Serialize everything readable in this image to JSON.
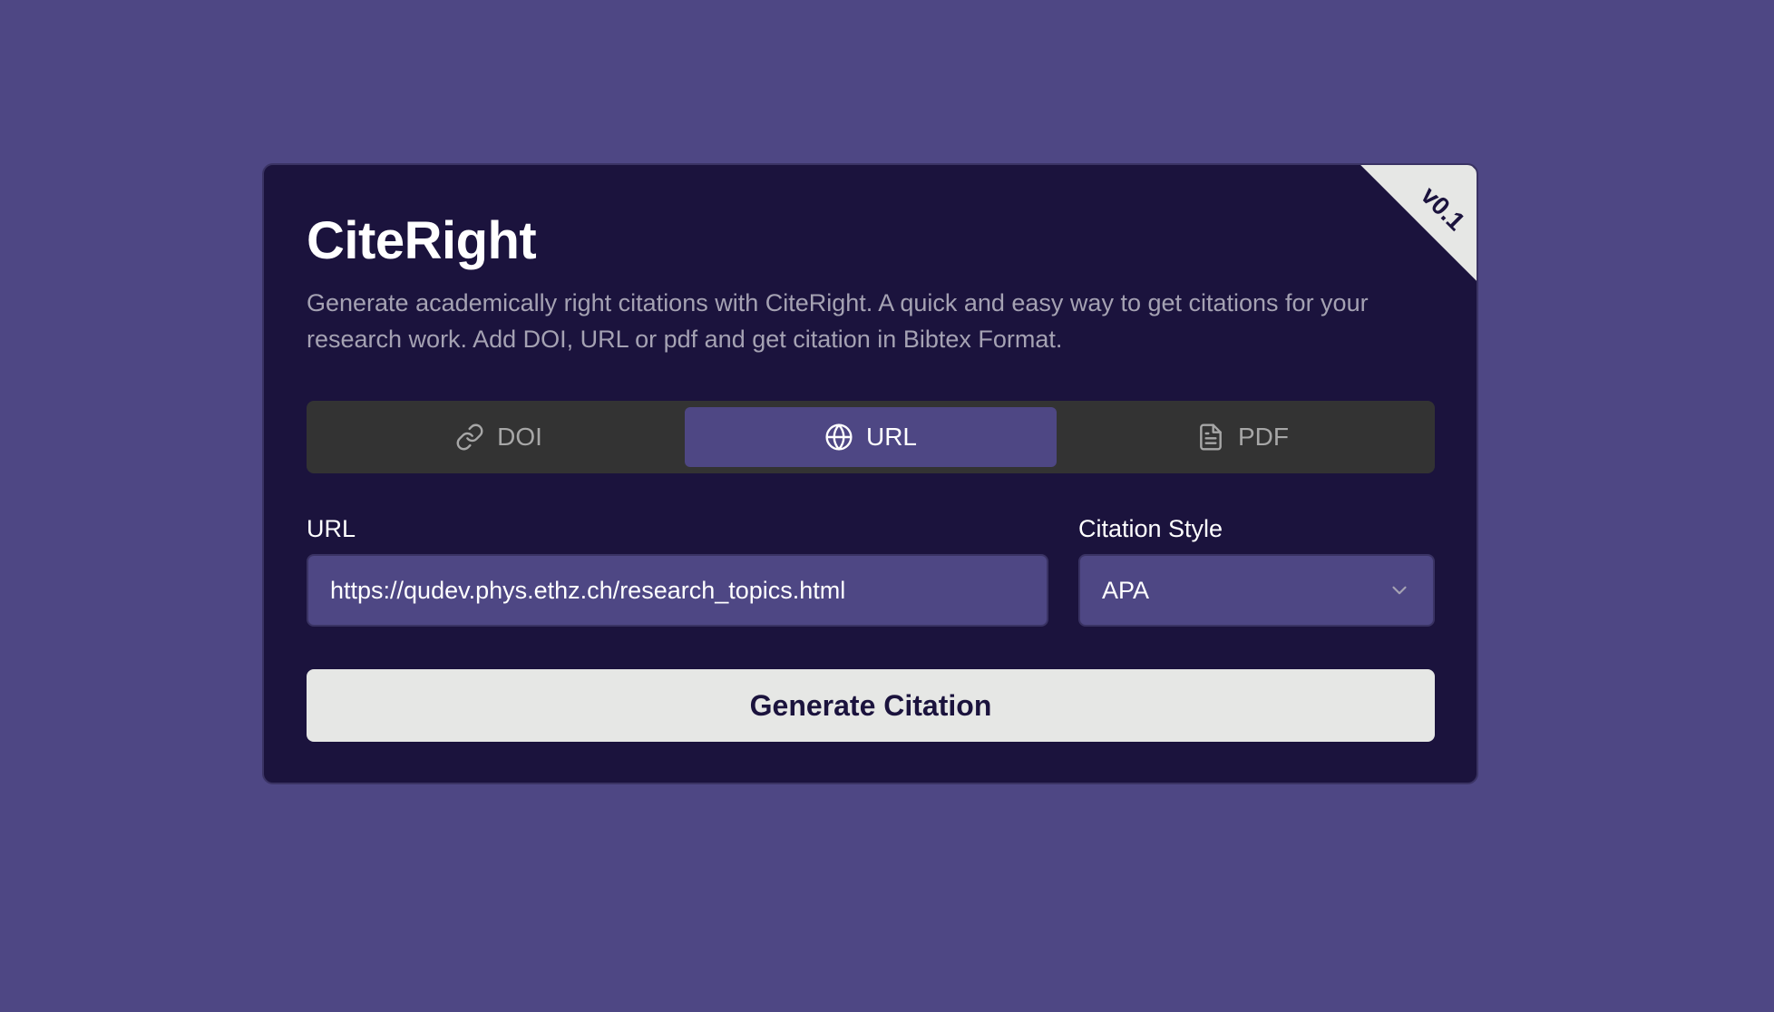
{
  "app": {
    "title": "CiteRight",
    "version": "v0.1",
    "description": "Generate academically right citations with CiteRight. A quick and easy way to get citations for your research work. Add DOI, URL or pdf and get citation in Bibtex Format."
  },
  "tabs": [
    {
      "label": "DOI",
      "icon": "link-icon",
      "active": false
    },
    {
      "label": "URL",
      "icon": "globe-icon",
      "active": true
    },
    {
      "label": "PDF",
      "icon": "file-icon",
      "active": false
    }
  ],
  "form": {
    "url_label": "URL",
    "url_value": "https://qudev.phys.ethz.ch/research_topics.html",
    "style_label": "Citation Style",
    "style_value": "APA",
    "submit_label": "Generate Citation"
  },
  "colors": {
    "background": "#4e4784",
    "card": "#1b133d",
    "accent": "#4e4784",
    "tab_bar": "#333333",
    "button": "#e6e7e5"
  }
}
